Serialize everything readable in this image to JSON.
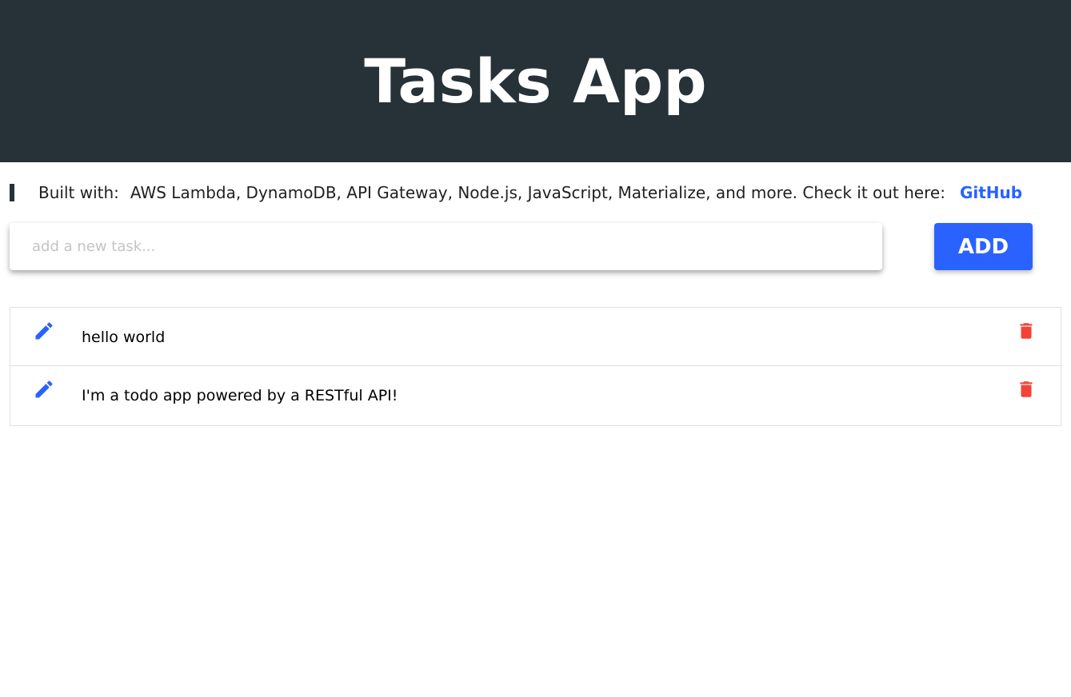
{
  "header": {
    "title": "Tasks App"
  },
  "built_with": {
    "label": "Built with:",
    "technologies": "AWS Lambda, DynamoDB, API Gateway, Node.js, JavaScript, Materialize, and more. Check it out here:",
    "link_text": "GitHub"
  },
  "new_task": {
    "placeholder": "add a new task...",
    "value": "",
    "add_label": "ADD"
  },
  "tasks": [
    {
      "text": "hello world",
      "edit_icon": "pencil-icon",
      "delete_icon": "trash-icon"
    },
    {
      "text": "I'm a todo app powered by a RESTful API!",
      "edit_icon": "pencil-icon",
      "delete_icon": "trash-icon"
    }
  ],
  "colors": {
    "header_bg": "#263238",
    "accent": "#2962ff",
    "delete": "#f44336"
  }
}
